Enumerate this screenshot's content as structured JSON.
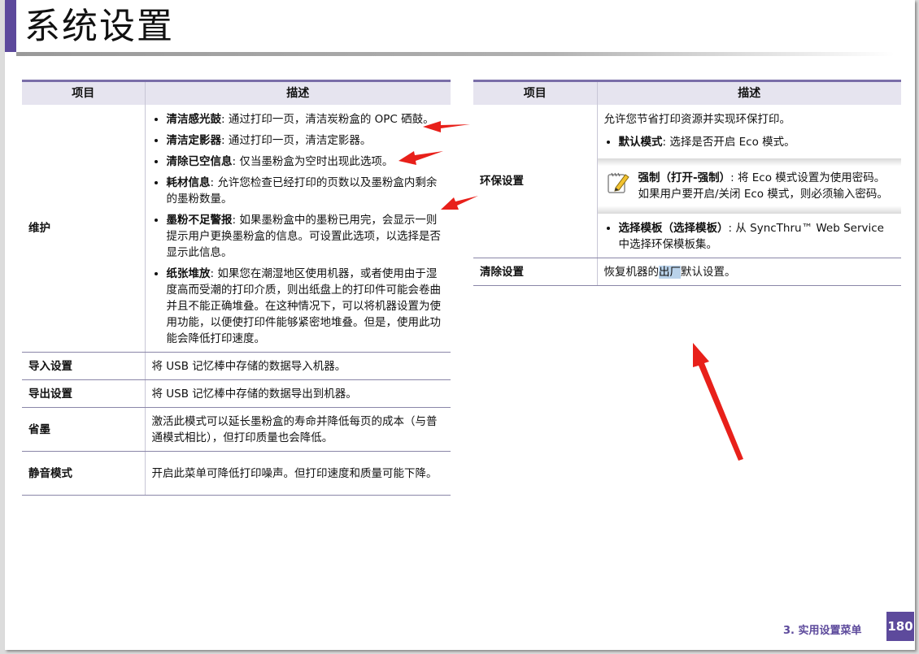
{
  "page": {
    "title": "系统设置",
    "footer": "3.  实用设置菜单",
    "page_number": "180"
  },
  "left_table": {
    "headers": {
      "item": "项目",
      "desc": "描述"
    },
    "maintenance": {
      "item": "维护",
      "bullets": [
        {
          "term": "清洁感光鼓",
          "text": ": 通过打印一页，清洁炭粉盒的 OPC 硒鼓。"
        },
        {
          "term": "清洁定影器",
          "text": ": 通过打印一页，清洁定影器。"
        },
        {
          "term": "清除已空信息",
          "text": ": 仅当墨粉盒为空时出现此选项。"
        },
        {
          "term": "耗材信息",
          "text": ": 允许您检查已经打印的页数以及墨粉盒内剩余的墨粉数量。"
        },
        {
          "term": "墨粉不足警报",
          "text": ": 如果墨粉盒中的墨粉已用完，会显示一则提示用户更换墨粉盒的信息。可设置此选项，以选择是否显示此信息。"
        },
        {
          "term": "纸张堆放",
          "text": ": 如果您在潮湿地区使用机器，或者使用由于湿度高而受潮的打印介质，则出纸盘上的打印件可能会卷曲并且不能正确堆叠。在这种情况下，可以将机器设置为使用功能，以便使打印件能够紧密地堆叠。但是，使用此功能会降低打印速度。"
        }
      ]
    },
    "rows": [
      {
        "item": "导入设置",
        "desc": "将 USB 记忆棒中存储的数据导入机器。"
      },
      {
        "item": "导出设置",
        "desc": "将 USB 记忆棒中存储的数据导出到机器。"
      },
      {
        "item": "省墨",
        "desc": "激活此模式可以延长墨粉盒的寿命并降低每页的成本（与普通模式相比），但打印质量也会降低。"
      },
      {
        "item": "静音模式",
        "desc": "开启此菜单可降低打印噪声。但打印速度和质量可能下降。"
      }
    ]
  },
  "right_table": {
    "headers": {
      "item": "项目",
      "desc": "描述"
    },
    "eco": {
      "item": "环保设置",
      "intro": "允许您节省打印资源并实现环保打印。",
      "bullet1": {
        "term": "默认模式",
        "text": ": 选择是否开启 Eco 模式。"
      },
      "note": {
        "term": "强制",
        "paren": "（打开-强制）",
        "text": ": 将 Eco 模式设置为使用密码。如果用户要开启/关闭 Eco 模式，则必须输入密码。"
      },
      "bullet2": {
        "term": "选择模板",
        "paren": "（选择模板）",
        "text": ": 从 SyncThru™ Web Service 中选择环保模板集。"
      }
    },
    "reset": {
      "item": "清除设置",
      "desc_pre": "恢复机器的",
      "desc_hl": "出厂",
      "desc_post": "默认设置。"
    }
  },
  "colors": {
    "accent": "#5d4a9c",
    "arrow": "#e8201a",
    "header_bg": "#e6e4ef"
  },
  "icons": {
    "note": "pencil-note-icon"
  }
}
